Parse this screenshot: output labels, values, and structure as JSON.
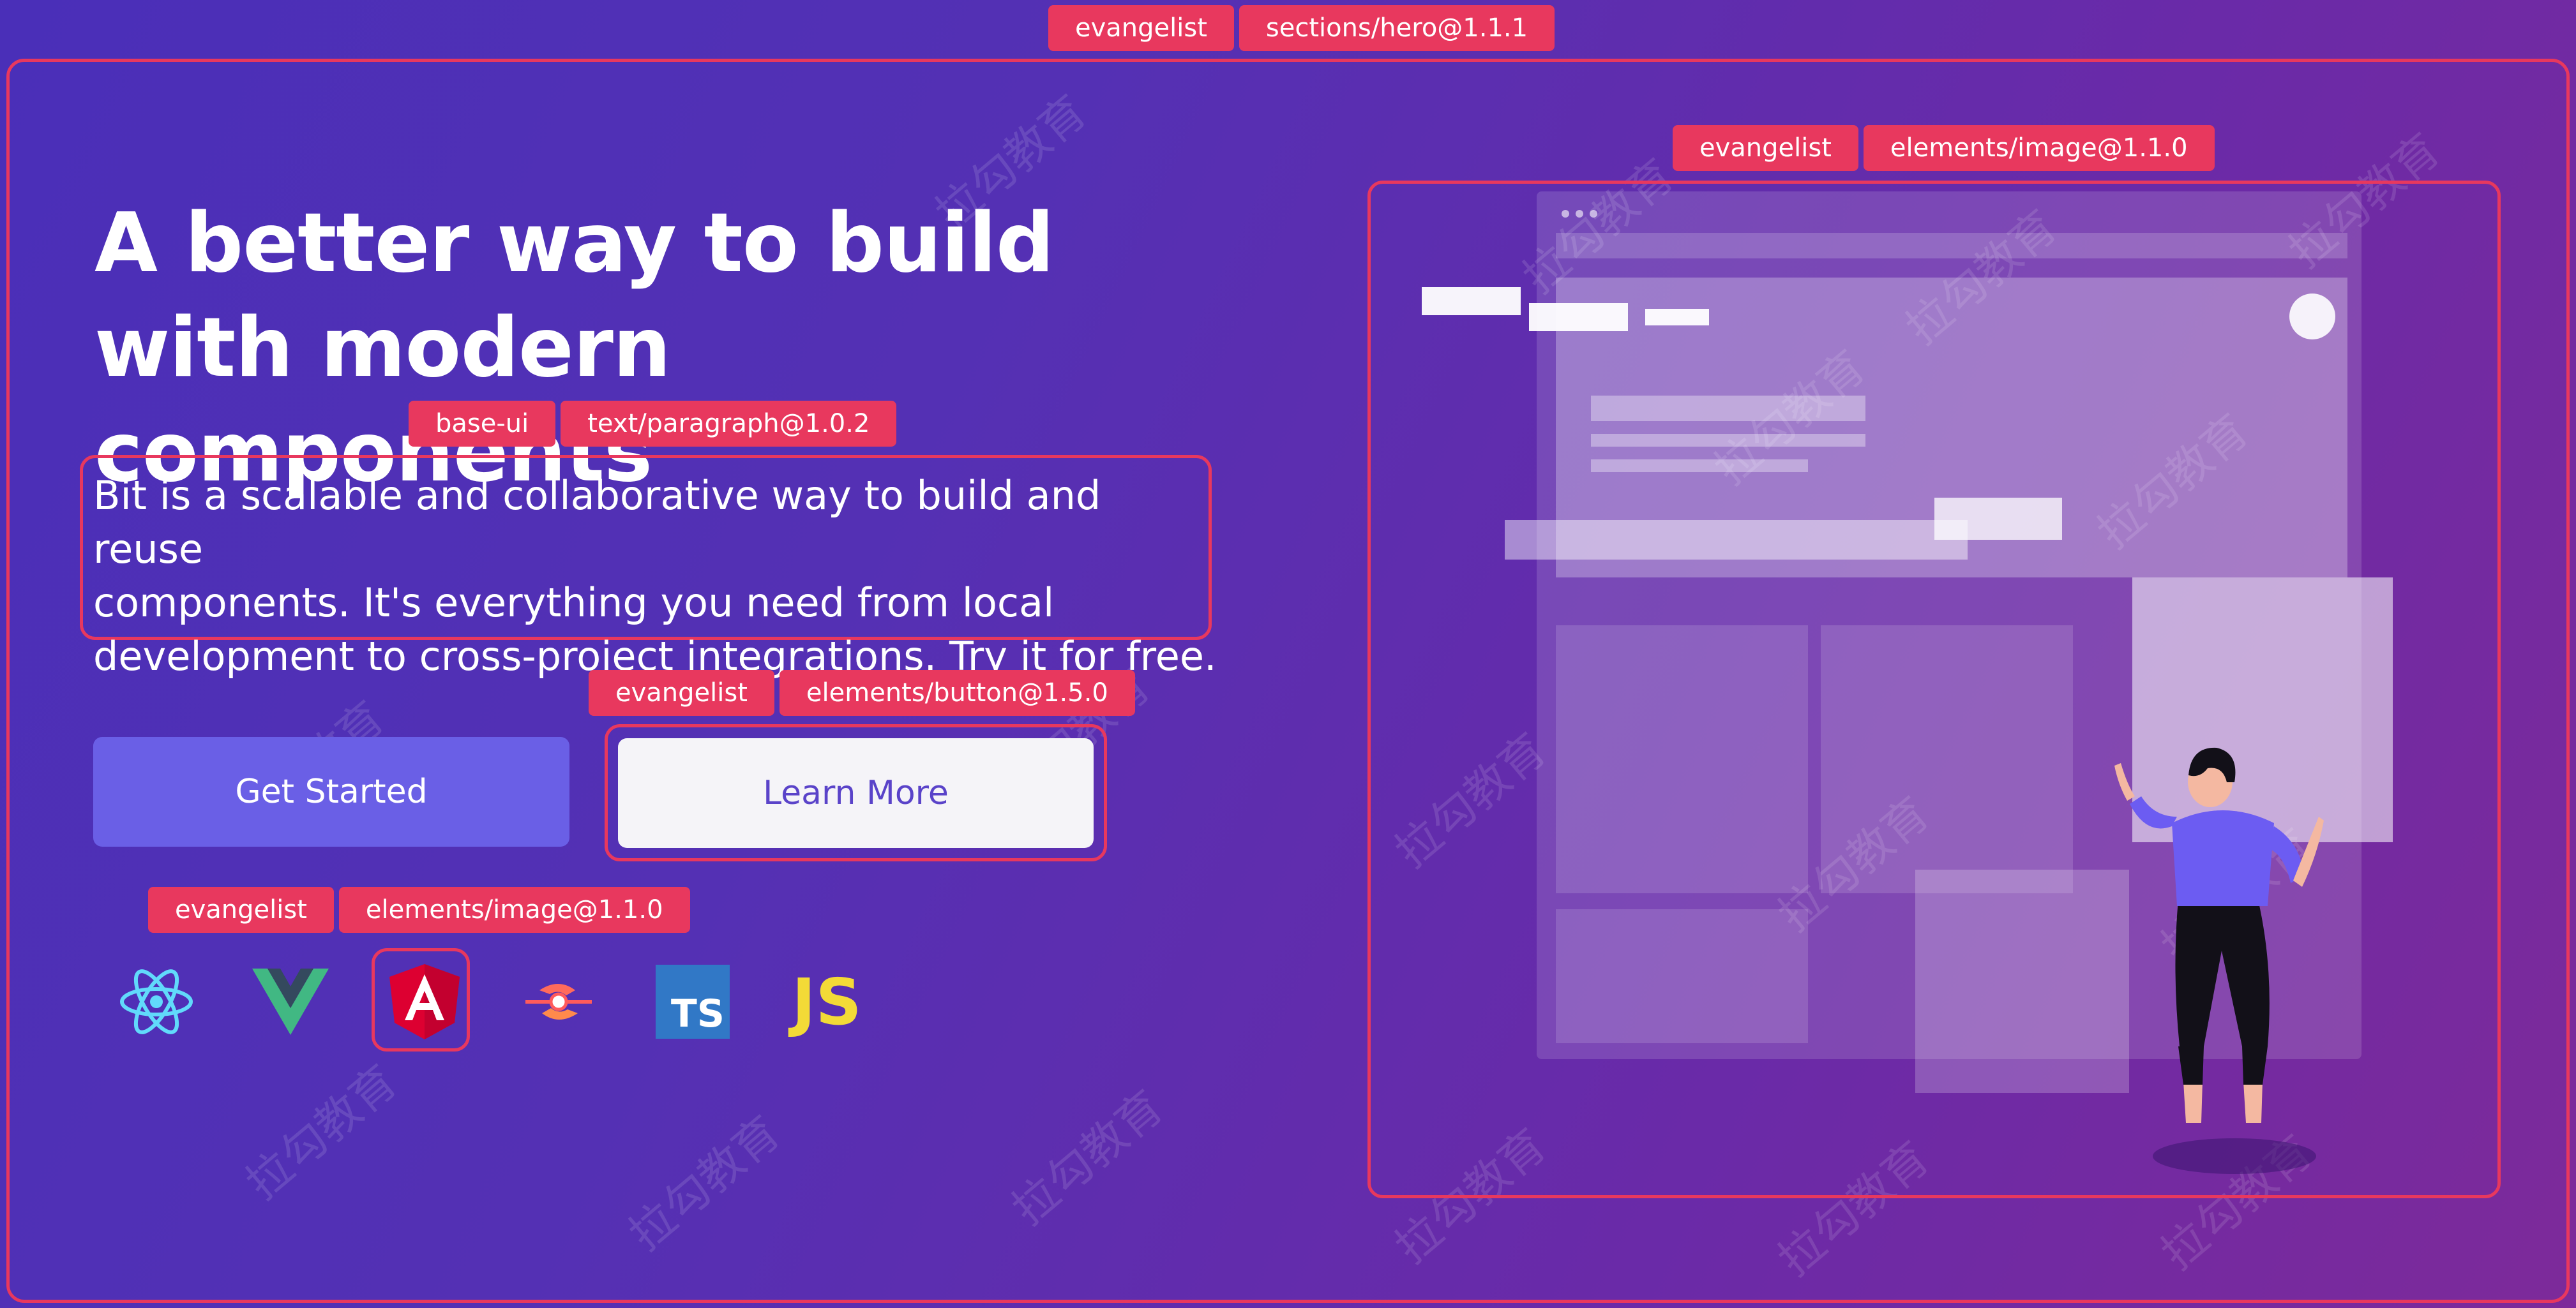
{
  "hero_tags": [
    "evangelist",
    "sections/hero@1.1.1"
  ],
  "headline": {
    "line1": "A better way to build",
    "line2": "with modern components"
  },
  "paragraph_tags": [
    "base-ui",
    "text/paragraph@1.0.2"
  ],
  "paragraph": {
    "line1": "Bit is a scalable and collaborative way to build and reuse",
    "line2": "components. It's everything you need from local",
    "line3": "development to cross-project integrations. Try it for free."
  },
  "button_tags": [
    "evangelist",
    "elements/button@1.5.0"
  ],
  "buttons": {
    "primary": "Get Started",
    "secondary": "Learn More"
  },
  "icons_tags": [
    "evangelist",
    "elements/image@1.1.0"
  ],
  "image_tags": [
    "evangelist",
    "elements/image@1.1.0"
  ],
  "framework_icons": {
    "react": "react-icon",
    "vue": "vue-icon",
    "angular": "angular-icon",
    "stencil": "stencil-icon",
    "typescript_label": "TS",
    "javascript_label": "JS"
  },
  "watermark": "拉勾教育",
  "colors": {
    "accent_tag": "#e8385e",
    "primary_button": "#6a5fe6",
    "background_start": "#4a2fb8",
    "background_end": "#7d2a9a"
  }
}
